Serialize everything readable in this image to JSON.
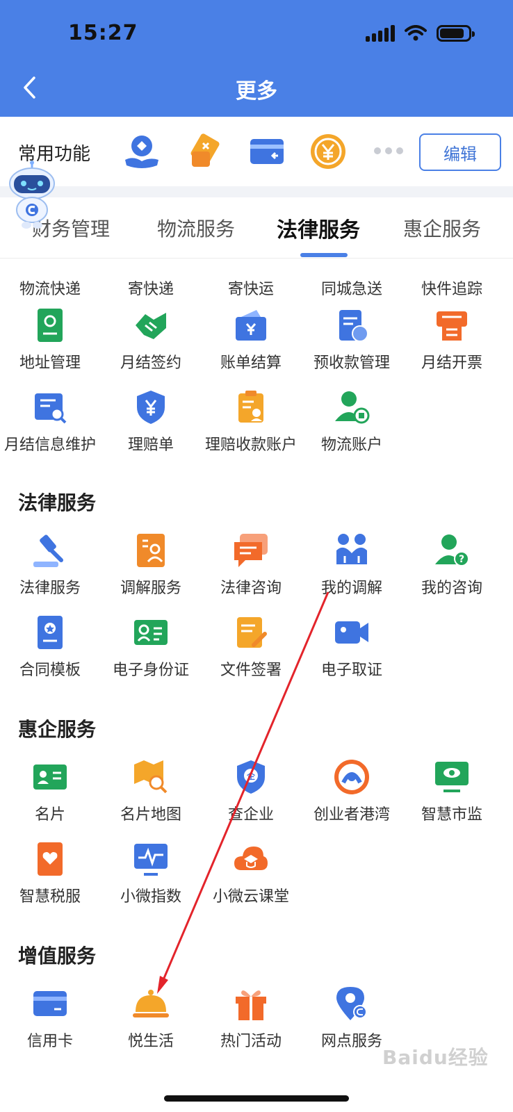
{
  "status_bar": {
    "time": "15:27"
  },
  "nav": {
    "title": "更多"
  },
  "common": {
    "label": "常用功能",
    "icons": [
      "hand-person-icon",
      "coupon-tag-icon",
      "card-return-icon",
      "yuan-coin-icon"
    ],
    "edit_label": "编辑"
  },
  "tabs": [
    {
      "label": "财务管理",
      "active": false
    },
    {
      "label": "物流服务",
      "active": false
    },
    {
      "label": "法律服务",
      "active": true
    },
    {
      "label": "惠企服务",
      "active": false
    }
  ],
  "sections": {
    "logistics_partial": [
      "物流快递",
      "寄快递",
      "寄快运",
      "同城急送",
      "快件追踪"
    ],
    "logistics": [
      {
        "label": "地址管理",
        "icon": "address-book-icon",
        "color": "#22a55a"
      },
      {
        "label": "月结签约",
        "icon": "handshake-icon",
        "color": "#22a55a"
      },
      {
        "label": "账单结算",
        "icon": "bill-yuan-icon",
        "color": "#3f74e0"
      },
      {
        "label": "预收款管理",
        "icon": "prepay-doc-icon",
        "color": "#3f74e0"
      },
      {
        "label": "月结开票",
        "icon": "invoice-printer-icon",
        "color": "#f26a2a"
      },
      {
        "label": "月结信息维护",
        "icon": "doc-search-icon",
        "color": "#3f74e0"
      },
      {
        "label": "理赔单",
        "icon": "shield-yuan-icon",
        "color": "#3f74e0"
      },
      {
        "label": "理赔收款账户",
        "icon": "clipboard-person-icon",
        "color": "#f4a62a"
      },
      {
        "label": "物流账户",
        "icon": "user-box-icon",
        "color": "#22a55a"
      }
    ],
    "legal_title": "法律服务",
    "legal": [
      {
        "label": "法律服务",
        "icon": "gavel-icon",
        "color": "#3f74e0"
      },
      {
        "label": "调解服务",
        "icon": "mediation-doc-icon",
        "color": "#f08a2a"
      },
      {
        "label": "法律咨询",
        "icon": "chat-bubble-icon",
        "color": "#f26a2a"
      },
      {
        "label": "我的调解",
        "icon": "two-people-icon",
        "color": "#3f74e0"
      },
      {
        "label": "我的咨询",
        "icon": "user-question-icon",
        "color": "#22a55a"
      },
      {
        "label": "合同模板",
        "icon": "contract-book-icon",
        "color": "#3f74e0"
      },
      {
        "label": "电子身份证",
        "icon": "id-card-icon",
        "color": "#22a55a"
      },
      {
        "label": "文件签署",
        "icon": "doc-sign-icon",
        "color": "#f4a62a"
      },
      {
        "label": "电子取证",
        "icon": "video-camera-icon",
        "color": "#3f74e0"
      }
    ],
    "enterprise_title": "惠企服务",
    "enterprise": [
      {
        "label": "名片",
        "icon": "business-card-icon",
        "color": "#22a55a"
      },
      {
        "label": "名片地图",
        "icon": "map-search-icon",
        "color": "#f4a62a"
      },
      {
        "label": "查企业",
        "icon": "shield-company-icon",
        "color": "#3f74e0"
      },
      {
        "label": "创业者港湾",
        "icon": "harbor-logo-icon",
        "color": "#3f74e0"
      },
      {
        "label": "智慧市监",
        "icon": "monitor-eye-icon",
        "color": "#22a55a"
      },
      {
        "label": "智慧税服",
        "icon": "tax-heart-icon",
        "color": "#f26a2a"
      },
      {
        "label": "小微指数",
        "icon": "pulse-monitor-icon",
        "color": "#3f74e0"
      },
      {
        "label": "小微云课堂",
        "icon": "cloud-class-icon",
        "color": "#f26a2a"
      }
    ],
    "value_title": "增值服务",
    "value": [
      {
        "label": "信用卡",
        "icon": "credit-card-icon",
        "color": "#3f74e0"
      },
      {
        "label": "悦生活",
        "icon": "food-cloche-icon",
        "color": "#f4a62a"
      },
      {
        "label": "热门活动",
        "icon": "gift-box-icon",
        "color": "#f26a2a"
      },
      {
        "label": "网点服务",
        "icon": "location-pin-icon",
        "color": "#3f74e0"
      }
    ]
  },
  "watermark": "Baidu经验"
}
